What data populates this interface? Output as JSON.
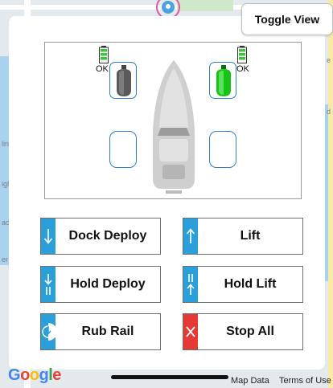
{
  "toolbar": {
    "toggle_view_label": "Toggle View"
  },
  "status": {
    "left_battery": "OK",
    "right_battery": "OK",
    "colors": {
      "battery": "#3cc43c",
      "motor_active": "#17c317",
      "motor_inactive": "#555555",
      "outline": "#2f80d6"
    }
  },
  "controls": {
    "dock_deploy": "Dock Deploy",
    "lift": "Lift",
    "hold_deploy": "Hold Deploy",
    "hold_lift": "Hold Lift",
    "rub_rail": "Rub Rail",
    "stop_all": "Stop All"
  },
  "map": {
    "logo": "Google",
    "map_data": "Map Data",
    "terms": "Terms of Use"
  },
  "icons": {
    "dock_deploy": "arrow-down-icon",
    "lift": "arrow-up-icon",
    "hold_deploy": "arrow-down-hold-icon",
    "hold_lift": "hold-arrow-up-icon",
    "rub_rail": "rub-rail-icon",
    "stop_all": "x-icon"
  }
}
